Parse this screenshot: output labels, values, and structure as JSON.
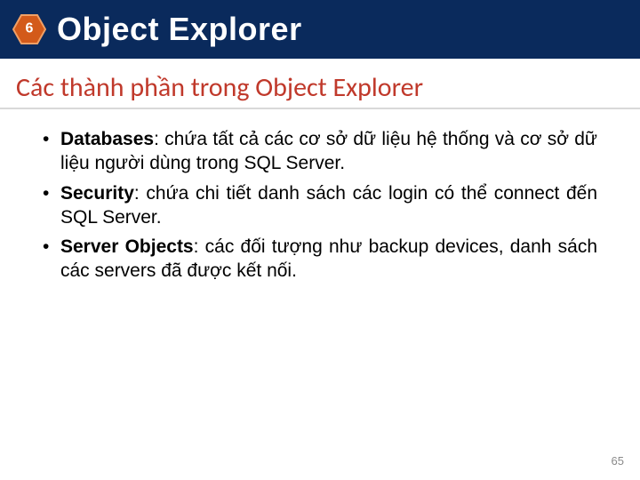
{
  "header": {
    "badge_number": "6",
    "title": "Object Explorer"
  },
  "subtitle": "Các thành phần trong Object Explorer",
  "bullets": [
    {
      "bold": "Databases",
      "rest": ": chứa tất cả các cơ sở dữ liệu hệ thống và cơ sở dữ liệu người dùng trong SQL Server."
    },
    {
      "bold": "Security",
      "rest": ": chứa chi tiết danh sách các login có thể connect đến SQL Server."
    },
    {
      "bold": "Server Objects",
      "rest": ": các đối tượng như backup devices, danh sách các servers đã được kết nối."
    }
  ],
  "page_number": "65",
  "colors": {
    "header_bg": "#0a2a5c",
    "subtitle": "#c0392b",
    "badge_fill": "#d35a1a",
    "badge_stroke_light": "#f0a066"
  }
}
